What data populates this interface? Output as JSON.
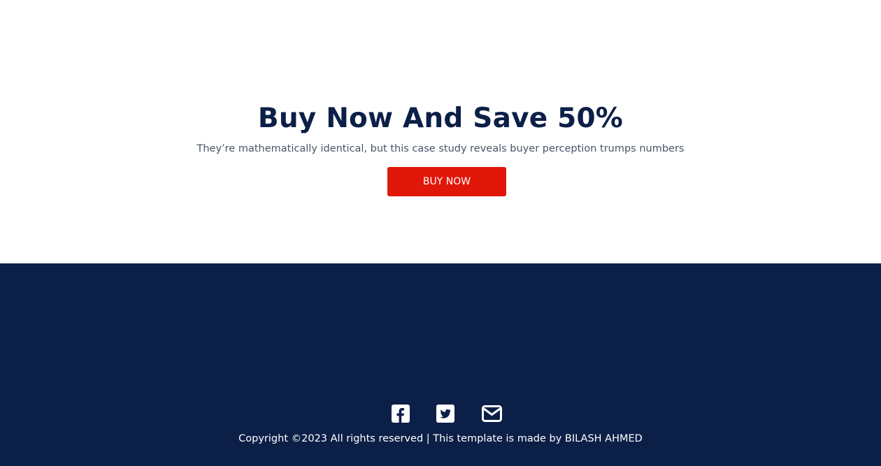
{
  "cta": {
    "title": "Buy Now And Save 50%",
    "subtitle": "They’re mathematically identical, but this case study reveals buyer perception trumps numbers",
    "button_label": "BUY NOW"
  },
  "footer": {
    "social_icons": [
      "facebook-square-icon",
      "twitter-square-icon",
      "envelope-icon"
    ],
    "copyright": "Copyright ©2023 All rights reserved | This template is made by BILASH AHMED"
  },
  "colors": {
    "navy": "#0c1f47",
    "accent_red": "#e1170a",
    "subtitle_gray": "#4a5468",
    "white": "#ffffff"
  }
}
